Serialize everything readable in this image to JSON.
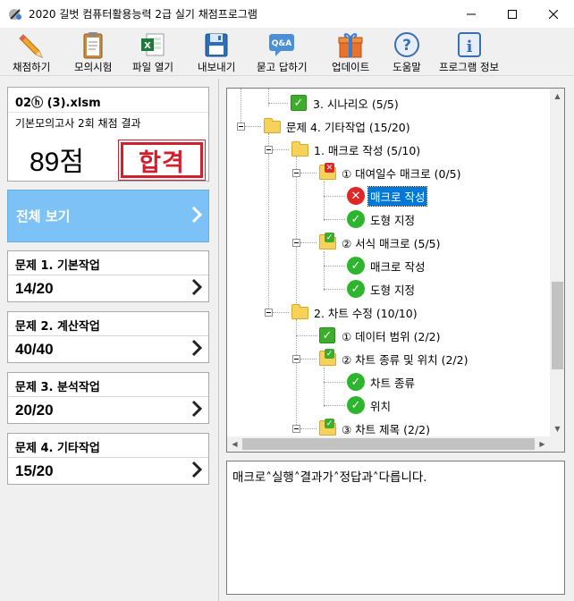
{
  "window": {
    "title": "2020 길벗 컴퓨터활용능력 2급 실기 채점프로그램"
  },
  "toolbar": [
    {
      "label": "채점하기",
      "icon": "pencil-icon"
    },
    {
      "label": "모의시험",
      "icon": "clipboard-icon"
    },
    {
      "label": "파일 열기",
      "icon": "excel-file-icon"
    },
    {
      "label": "내보내기",
      "icon": "floppy-disk-icon"
    },
    {
      "label": "묻고 답하기",
      "icon": "qa-icon"
    },
    {
      "label": "업데이트",
      "icon": "gift-icon"
    },
    {
      "label": "도움말",
      "icon": "help-icon"
    },
    {
      "label": "프로그램 정보",
      "icon": "info-icon"
    }
  ],
  "file": {
    "name": "02ⓗ (3).xlsm",
    "subtitle": "기본모의고사 2회 채점 결과",
    "score": "89점",
    "stamp": "합격"
  },
  "all_view": {
    "label": "전체 보기"
  },
  "questions": [
    {
      "title": "문제 1. 기본작업",
      "score": "14/20"
    },
    {
      "title": "문제 2. 계산작업",
      "score": "40/40"
    },
    {
      "title": "문제 3. 분석작업",
      "score": "20/20"
    },
    {
      "title": "문제 4. 기타작업",
      "score": "15/20"
    }
  ],
  "tree": [
    {
      "label": "3. 시나리오 (5/5)",
      "type": "check"
    },
    {
      "label": "문제 4. 기타작업 (15/20)",
      "type": "folder"
    },
    {
      "label": "1. 매크로 작성 (5/10)",
      "type": "folder"
    },
    {
      "label": "① 대여일수 매크로 (0/5)",
      "type": "folder-bad"
    },
    {
      "label": "매크로 작성",
      "type": "bad",
      "selected": true
    },
    {
      "label": "도형 지정",
      "type": "ok"
    },
    {
      "label": "② 서식 매크로 (5/5)",
      "type": "folder-ok"
    },
    {
      "label": "매크로 작성",
      "type": "ok"
    },
    {
      "label": "도형 지정",
      "type": "ok"
    },
    {
      "label": "2. 차트 수정 (10/10)",
      "type": "folder"
    },
    {
      "label": "① 데이터 범위 (2/2)",
      "type": "check"
    },
    {
      "label": "② 차트 종류 및 위치 (2/2)",
      "type": "folder-ok"
    },
    {
      "label": "차트 종류",
      "type": "ok"
    },
    {
      "label": "위치",
      "type": "ok"
    },
    {
      "label": "③ 차트 제목 (2/2)",
      "type": "folder-ok"
    }
  ],
  "message": "매크로˄실행˄결과가˄정답과˄다릅니다."
}
